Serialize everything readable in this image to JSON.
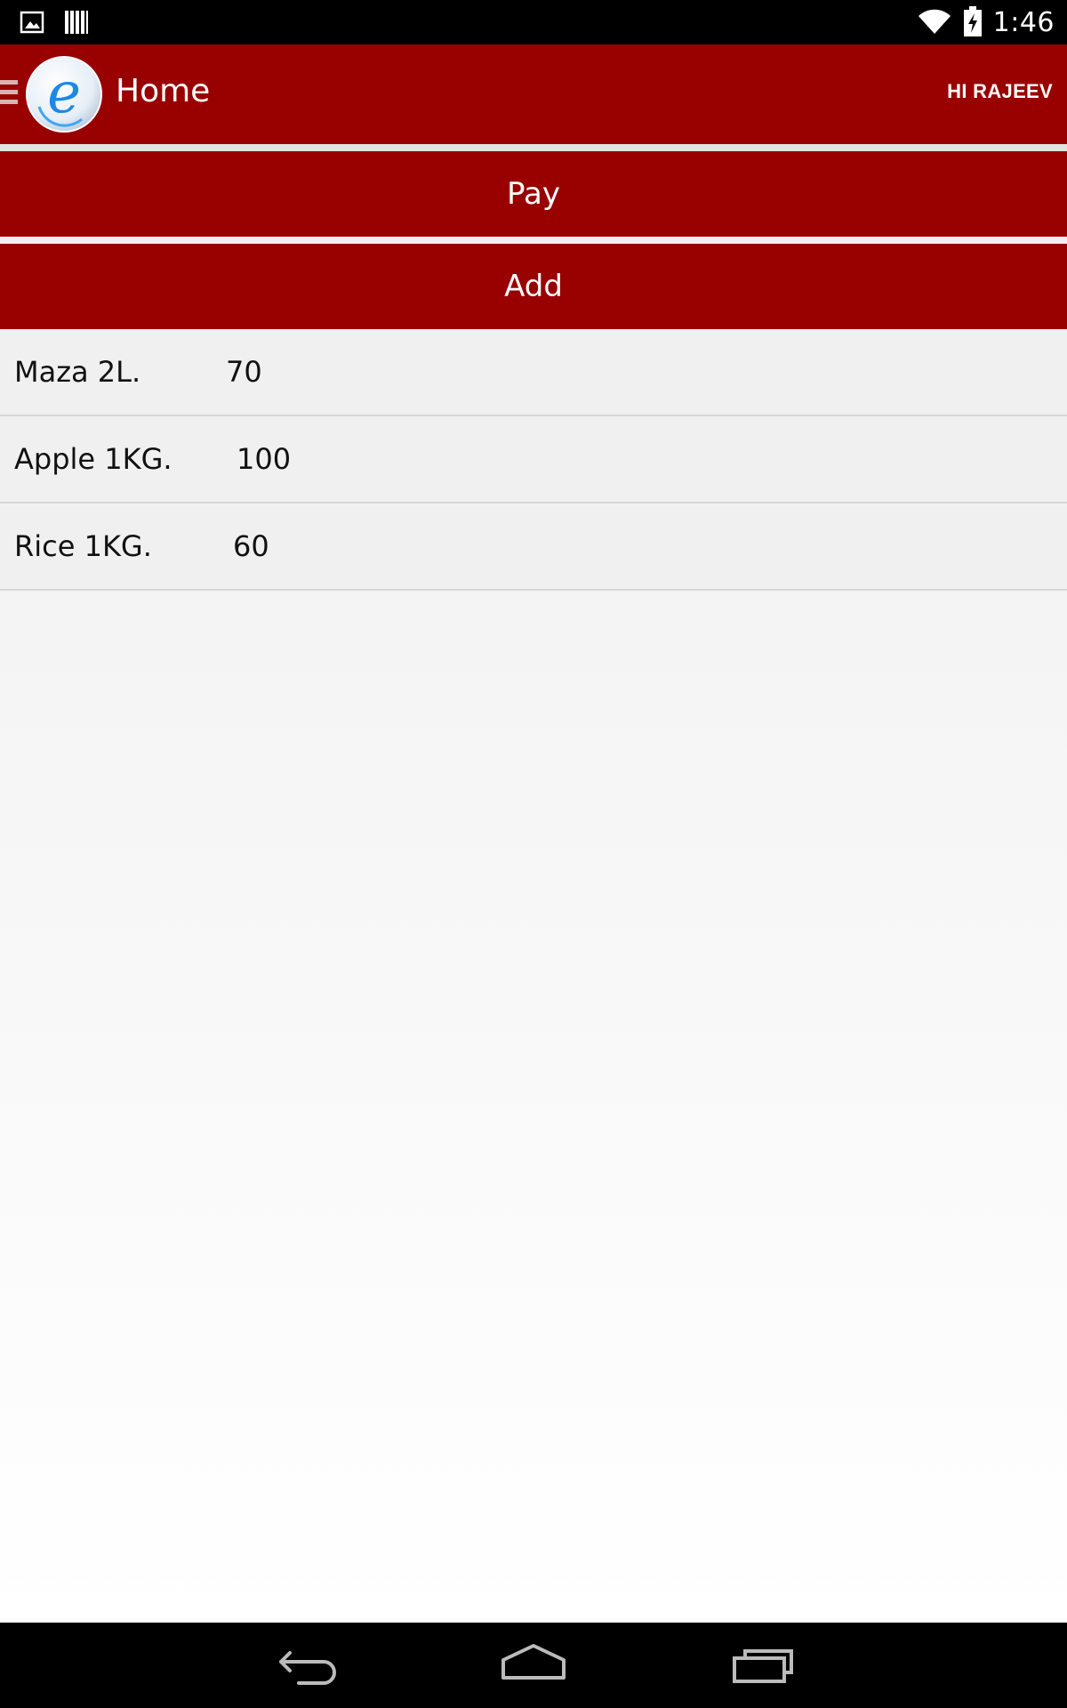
{
  "status_bar": {
    "time": "1:46",
    "icons": [
      "image-icon",
      "barcode-icon",
      "wifi-icon",
      "battery-charging-icon"
    ]
  },
  "action_bar": {
    "title": "Home",
    "greeting": "HI RAJEEV",
    "logo_icon": "app-logo-e-icon",
    "colors": {
      "primary": "#990000",
      "text": "#ffffff"
    }
  },
  "buttons": {
    "pay_label": "Pay",
    "add_label": "Add"
  },
  "items": [
    {
      "name": "Maza 2L.",
      "price": "70"
    },
    {
      "name": "Apple 1KG.",
      "price": "100"
    },
    {
      "name": "Rice 1KG.",
      "price": "60"
    }
  ],
  "nav_bar": {
    "icons": [
      "back-icon",
      "home-icon",
      "recent-apps-icon"
    ]
  }
}
